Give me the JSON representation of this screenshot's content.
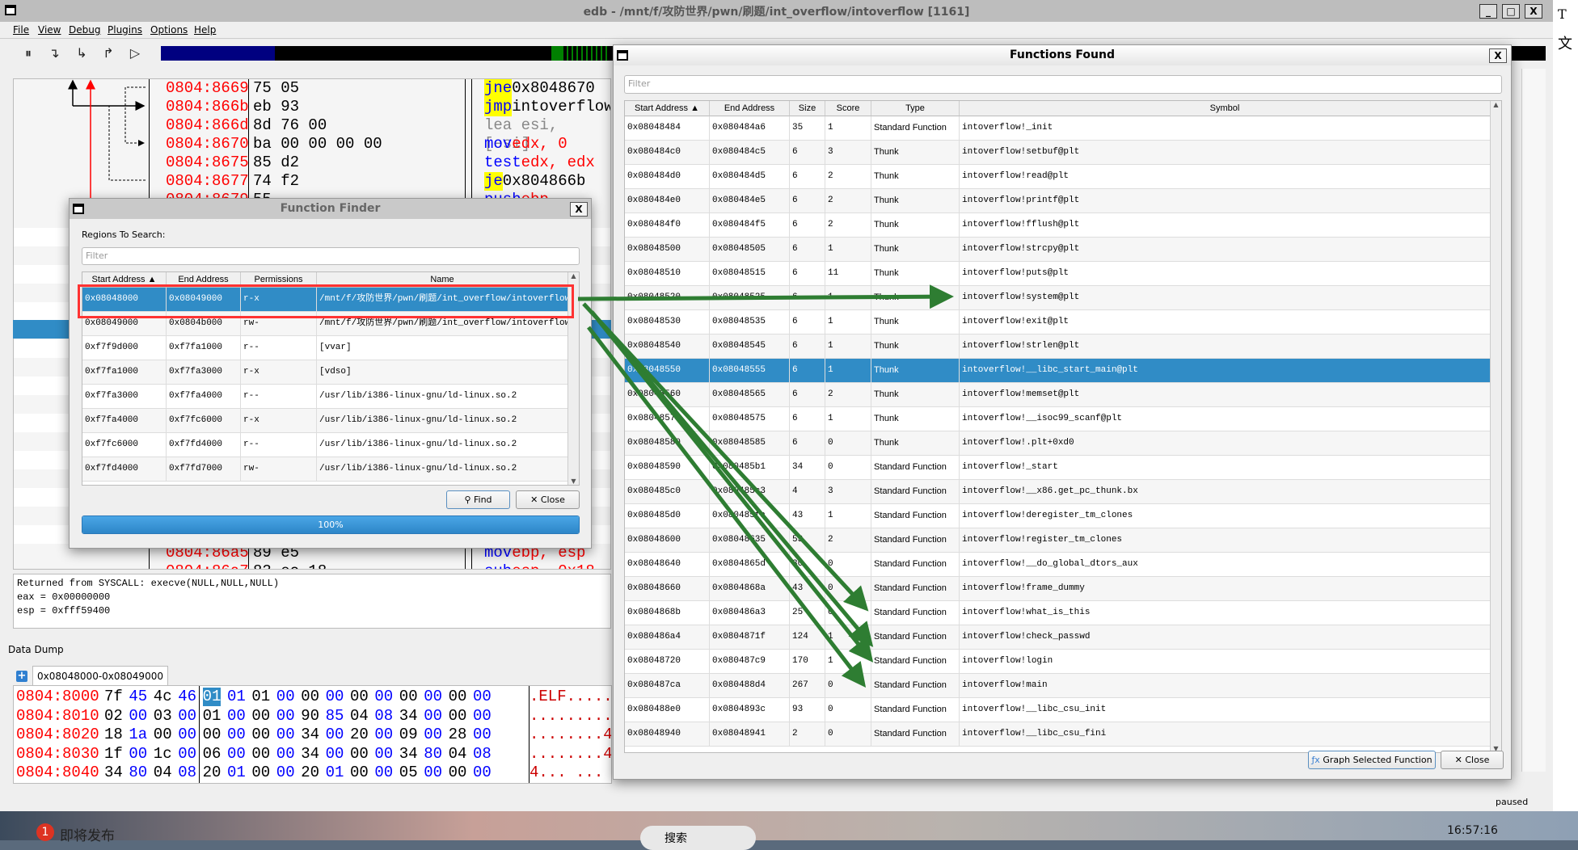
{
  "window": {
    "title": "edb - /mnt/f/攻防世界/pwn/刷题/int_overflow/intoverflow [1161]",
    "min": "_",
    "max": "□",
    "close": "X"
  },
  "menu": [
    "File",
    "View",
    "Debug",
    "Plugins",
    "Options",
    "Help"
  ],
  "toolbar": {
    "icons": [
      "pause-icon",
      "step-into-icon",
      "step-over-icon",
      "step-out-icon",
      "run-icon"
    ],
    "glyphs": [
      "⏸",
      "↴",
      "↳",
      "↱",
      "▷"
    ]
  },
  "region_bar_colors": {
    "code": "#000080",
    "data": "#000000",
    "current": "#008000"
  },
  "disassembly": [
    {
      "addr": "0804:8669",
      "bytes": "75 05",
      "mn": "jne",
      "ops": " 0x8048670",
      "jump": true
    },
    {
      "addr": "0804:866b",
      "bytes": "eb 93",
      "mn": "jmp",
      "ops": " intoverflow",
      "jump": true
    },
    {
      "addr": "0804:866d",
      "bytes": "8d 76 00",
      "mn": "lea esi, [esi]",
      "ops": "",
      "nop": true
    },
    {
      "addr": "0804:8670",
      "bytes": "ba 00 00 00 00",
      "mn": "mov",
      "ops": " edx, 0"
    },
    {
      "addr": "0804:8675",
      "bytes": "85 d2",
      "mn": "test",
      "ops": " edx, edx"
    },
    {
      "addr": "0804:8677",
      "bytes": "74 f2",
      "mn": "je",
      "ops": " 0x804866b",
      "jump": true
    },
    {
      "addr": "0804:8679",
      "bytes": "55",
      "mn": "push",
      "ops": " ebp"
    }
  ],
  "disassembly_bottom": [
    {
      "addr": "0804:86a5",
      "bytes": "89 e5",
      "mn": "mov",
      "ops": " ebp, esp"
    },
    {
      "addr": "0804:86a7",
      "bytes": "83 ec 18",
      "mn": "sub",
      "ops": " esp, 0x18"
    }
  ],
  "log": [
    "Returned from SYSCALL: execve(NULL,NULL,NULL)",
    "eax = 0x00000000",
    "esp = 0xfff59400"
  ],
  "data_dump": {
    "label": "Data Dump",
    "tab": "0x08048000-0x08049000",
    "rows": [
      {
        "addr": "0804:8000",
        "hex": [
          "7f",
          "45",
          "4c",
          "46",
          "01",
          "01",
          "01",
          "00",
          "00",
          "00",
          "00",
          "00",
          "00",
          "00",
          "00",
          "00"
        ],
        "ascii": ".ELF....."
      },
      {
        "addr": "0804:8010",
        "hex": [
          "02",
          "00",
          "03",
          "00",
          "01",
          "00",
          "00",
          "00",
          "90",
          "85",
          "04",
          "08",
          "34",
          "00",
          "00",
          "00"
        ],
        "ascii": "........."
      },
      {
        "addr": "0804:8020",
        "hex": [
          "18",
          "1a",
          "00",
          "00",
          "00",
          "00",
          "00",
          "00",
          "34",
          "00",
          "20",
          "00",
          "09",
          "00",
          "28",
          "00"
        ],
        "ascii": "........4"
      },
      {
        "addr": "0804:8030",
        "hex": [
          "1f",
          "00",
          "1c",
          "00",
          "06",
          "00",
          "00",
          "00",
          "34",
          "00",
          "00",
          "00",
          "34",
          "80",
          "04",
          "08"
        ],
        "ascii": "........4"
      },
      {
        "addr": "0804:8040",
        "hex": [
          "34",
          "80",
          "04",
          "08",
          "20",
          "01",
          "00",
          "00",
          "20",
          "01",
          "00",
          "00",
          "05",
          "00",
          "00",
          "00"
        ],
        "ascii": "4... ..."
      }
    ]
  },
  "function_finder": {
    "title": "Function Finder",
    "regions_label": "Regions To Search:",
    "filter_placeholder": "Filter",
    "columns": [
      "Start Address ▲",
      "End Address",
      "Permissions",
      "Name"
    ],
    "rows": [
      [
        "0x08048000",
        "0x08049000",
        "r-x",
        "/mnt/f/攻防世界/pwn/刷题/int_overflow/intoverflow"
      ],
      [
        "0x08049000",
        "0x0804b000",
        "rw-",
        "/mnt/f/攻防世界/pwn/刷题/int_overflow/intoverflow"
      ],
      [
        "0xf7f9d000",
        "0xf7fa1000",
        "r--",
        "[vvar]"
      ],
      [
        "0xf7fa1000",
        "0xf7fa3000",
        "r-x",
        "[vdso]"
      ],
      [
        "0xf7fa3000",
        "0xf7fa4000",
        "r--",
        "/usr/lib/i386-linux-gnu/ld-linux.so.2"
      ],
      [
        "0xf7fa4000",
        "0xf7fc6000",
        "r-x",
        "/usr/lib/i386-linux-gnu/ld-linux.so.2"
      ],
      [
        "0xf7fc6000",
        "0xf7fd4000",
        "r--",
        "/usr/lib/i386-linux-gnu/ld-linux.so.2"
      ],
      [
        "0xf7fd4000",
        "0xf7fd7000",
        "rw-",
        "/usr/lib/i386-linux-gnu/ld-linux.so.2"
      ]
    ],
    "selected": 0,
    "find": "Find",
    "close": "Close",
    "progress": "100%",
    "progress_value": 100
  },
  "functions_found": {
    "title": "Functions Found",
    "filter_placeholder": "Filter",
    "columns": [
      "Start Address ▲",
      "End Address",
      "Size",
      "Score",
      "Type",
      "Symbol"
    ],
    "rows": [
      [
        "0x08048484",
        "0x080484a6",
        "35",
        "1",
        "Standard Function",
        "intoverflow!_init"
      ],
      [
        "0x080484c0",
        "0x080484c5",
        "6",
        "3",
        "Thunk",
        "intoverflow!setbuf@plt"
      ],
      [
        "0x080484d0",
        "0x080484d5",
        "6",
        "2",
        "Thunk",
        "intoverflow!read@plt"
      ],
      [
        "0x080484e0",
        "0x080484e5",
        "6",
        "2",
        "Thunk",
        "intoverflow!printf@plt"
      ],
      [
        "0x080484f0",
        "0x080484f5",
        "6",
        "2",
        "Thunk",
        "intoverflow!fflush@plt"
      ],
      [
        "0x08048500",
        "0x08048505",
        "6",
        "1",
        "Thunk",
        "intoverflow!strcpy@plt"
      ],
      [
        "0x08048510",
        "0x08048515",
        "6",
        "11",
        "Thunk",
        "intoverflow!puts@plt"
      ],
      [
        "0x08048520",
        "0x08048525",
        "6",
        "1",
        "Thunk",
        "intoverflow!system@plt"
      ],
      [
        "0x08048530",
        "0x08048535",
        "6",
        "1",
        "Thunk",
        "intoverflow!exit@plt"
      ],
      [
        "0x08048540",
        "0x08048545",
        "6",
        "1",
        "Thunk",
        "intoverflow!strlen@plt"
      ],
      [
        "0x08048550",
        "0x08048555",
        "6",
        "1",
        "Thunk",
        "intoverflow!__libc_start_main@plt"
      ],
      [
        "0x08048560",
        "0x08048565",
        "6",
        "2",
        "Thunk",
        "intoverflow!memset@plt"
      ],
      [
        "0x08048570",
        "0x08048575",
        "6",
        "1",
        "Thunk",
        "intoverflow!__isoc99_scanf@plt"
      ],
      [
        "0x08048580",
        "0x08048585",
        "6",
        "0",
        "Thunk",
        "intoverflow!.plt+0xd0"
      ],
      [
        "0x08048590",
        "0x080485b1",
        "34",
        "0",
        "Standard Function",
        "intoverflow!_start"
      ],
      [
        "0x080485c0",
        "0x080485c3",
        "4",
        "3",
        "Standard Function",
        "intoverflow!__x86.get_pc_thunk.bx"
      ],
      [
        "0x080485d0",
        "0x080485fa",
        "43",
        "1",
        "Standard Function",
        "intoverflow!deregister_tm_clones"
      ],
      [
        "0x08048600",
        "0x08048635",
        "53",
        "2",
        "Standard Function",
        "intoverflow!register_tm_clones"
      ],
      [
        "0x08048640",
        "0x0804865d",
        "30",
        "0",
        "Standard Function",
        "intoverflow!__do_global_dtors_aux"
      ],
      [
        "0x08048660",
        "0x0804868a",
        "43",
        "0",
        "Standard Function",
        "intoverflow!frame_dummy"
      ],
      [
        "0x0804868b",
        "0x080486a3",
        "25",
        "0",
        "Standard Function",
        "intoverflow!what_is_this"
      ],
      [
        "0x080486a4",
        "0x0804871f",
        "124",
        "1",
        "Standard Function",
        "intoverflow!check_passwd"
      ],
      [
        "0x08048720",
        "0x080487c9",
        "170",
        "1",
        "Standard Function",
        "intoverflow!login"
      ],
      [
        "0x080487ca",
        "0x080488d4",
        "267",
        "0",
        "Standard Function",
        "intoverflow!main"
      ],
      [
        "0x080488e0",
        "0x0804893c",
        "93",
        "0",
        "Standard Function",
        "intoverflow!__libc_csu_init"
      ],
      [
        "0x08048940",
        "0x08048941",
        "2",
        "0",
        "Standard Function",
        "intoverflow!__libc_csu_fini"
      ]
    ],
    "selected": 10,
    "graph": "Graph Selected Function",
    "close": "Close"
  },
  "annotation_color": "#2e7d32",
  "highlight_color": "#ff3333",
  "status": "paused",
  "taskbar": {
    "badge": "1",
    "notice": "即将发布",
    "search": "搜索",
    "clock": "16:57:16"
  },
  "side_text": [
    "T",
    "文"
  ]
}
